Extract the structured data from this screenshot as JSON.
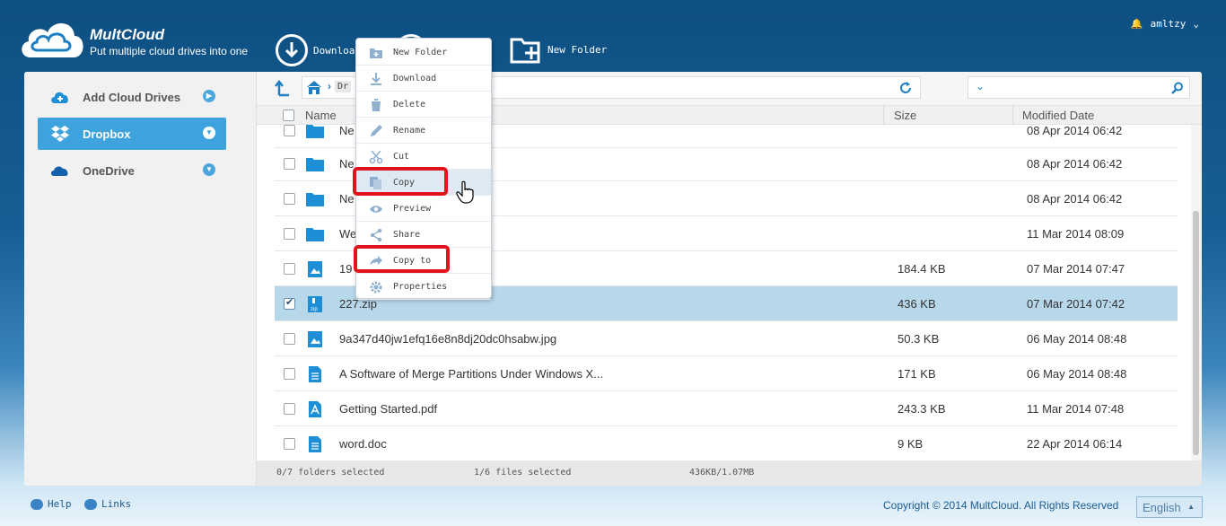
{
  "brand": {
    "name": "MultCloud",
    "tagline": "Put multiple cloud drives into one"
  },
  "toolbar": {
    "download_label": "Download",
    "new_folder_label": "New Folder"
  },
  "user": {
    "name": "amltzy"
  },
  "sidebar": {
    "items": [
      {
        "label": "Add Cloud Drives"
      },
      {
        "label": "Dropbox"
      },
      {
        "label": "OneDrive"
      }
    ]
  },
  "breadcrumb": {
    "current": "Dr"
  },
  "table": {
    "headers": {
      "name": "Name",
      "size": "Size",
      "modified": "Modified Date"
    },
    "rows": [
      {
        "name": "Ne",
        "size": "",
        "date": "08 Apr 2014 06:42",
        "type": "folder",
        "checked": false
      },
      {
        "name": "Ne",
        "size": "",
        "date": "08 Apr 2014 06:42",
        "type": "folder",
        "checked": false
      },
      {
        "name": "Ne",
        "size": "",
        "date": "08 Apr 2014 06:42",
        "type": "folder",
        "checked": false
      },
      {
        "name": "We",
        "size": "",
        "date": "11 Mar 2014 08:09",
        "type": "folder",
        "checked": false
      },
      {
        "name": "19",
        "size": "184.4 KB",
        "date": "07 Mar 2014 07:47",
        "type": "image",
        "checked": false
      },
      {
        "name": "227.zip",
        "size": "436 KB",
        "date": "07 Mar 2014 07:42",
        "type": "zip",
        "checked": true
      },
      {
        "name": "9a347d40jw1efq16e8n8dj20dc0hsabw.jpg",
        "size": "50.3 KB",
        "date": "06 May 2014 08:48",
        "type": "image",
        "checked": false
      },
      {
        "name": "A Software of Merge Partitions Under Windows X...",
        "size": "171 KB",
        "date": "06 May 2014 08:48",
        "type": "doc",
        "checked": false
      },
      {
        "name": "Getting Started.pdf",
        "size": "243.3 KB",
        "date": "11 Mar 2014 07:48",
        "type": "pdf",
        "checked": false
      },
      {
        "name": "word.doc",
        "size": "9 KB",
        "date": "22 Apr 2014 06:14",
        "type": "doc",
        "checked": false
      }
    ]
  },
  "status": {
    "folders": "0/7 folders selected",
    "files": "1/6 files selected",
    "size": "436KB/1.07MB"
  },
  "context_menu": {
    "items": [
      {
        "label": "New Folder",
        "icon": "new-folder-icon"
      },
      {
        "label": "Download",
        "icon": "download-icon"
      },
      {
        "label": "Delete",
        "icon": "trash-icon"
      },
      {
        "label": "Rename",
        "icon": "pencil-icon"
      },
      {
        "label": "Cut",
        "icon": "scissors-icon"
      },
      {
        "label": "Copy",
        "icon": "copy-icon"
      },
      {
        "label": "Preview",
        "icon": "eye-icon"
      },
      {
        "label": "Share",
        "icon": "share-icon"
      },
      {
        "label": "Copy to",
        "icon": "copy-to-icon"
      },
      {
        "label": "Properties",
        "icon": "gear-icon"
      }
    ]
  },
  "footer": {
    "help": "Help",
    "links": "Links",
    "copyright": "Copyright © 2014 MultCloud. All Rights Reserved",
    "language": "English"
  },
  "colors": {
    "accent": "#3ea3dc",
    "selected_row": "#b7d7ea",
    "highlight": "#e3131b"
  }
}
